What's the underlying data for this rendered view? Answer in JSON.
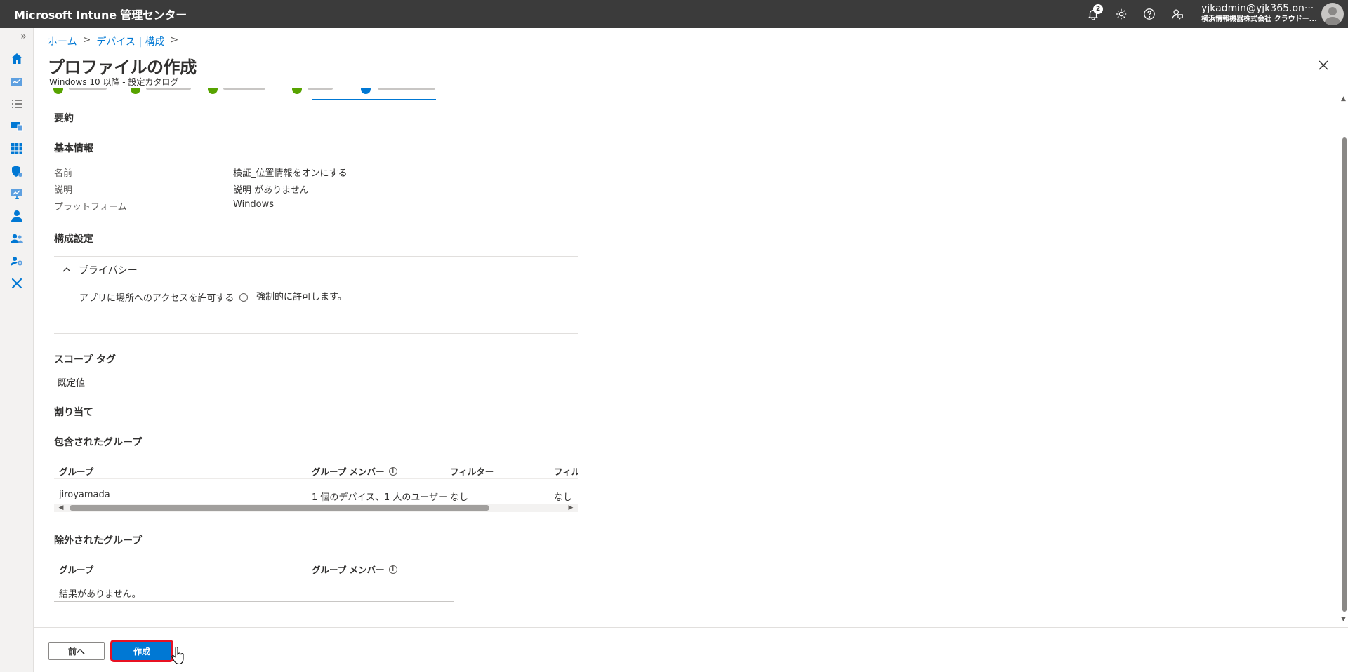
{
  "app": {
    "title": "Microsoft Intune 管理センター"
  },
  "topbar": {
    "notification_count": "2",
    "account_email": "yjkadmin@yjk365.on···",
    "account_org": "横浜情報機器株式会社  クラウドー..."
  },
  "nav": {
    "expand": "»",
    "items": [
      "home-icon",
      "dashboard-icon",
      "all-services-icon",
      "devices-icon",
      "apps-icon",
      "endpoint-security-icon",
      "reports-icon",
      "users-icon",
      "groups-icon",
      "tenant-admin-icon",
      "troubleshooting-icon"
    ]
  },
  "breadcrumb": {
    "home": "ホーム",
    "devices": "デバイス | 構成",
    "sep": ">"
  },
  "header": {
    "title": "プロファイルの作成",
    "more": "...",
    "subtitle": "Windows 10 以降 - 設定カタログ"
  },
  "summary": {
    "section_title": "要約",
    "basics_title": "基本情報",
    "basics": [
      {
        "label": "名前",
        "value": "検証_位置情報をオンにする"
      },
      {
        "label": "説明",
        "value": "説明 がありません"
      },
      {
        "label": "プラットフォーム",
        "value": "Windows"
      }
    ],
    "config_title": "構成設定",
    "category": "プライバシー",
    "setting_label": "アプリに場所へのアクセスを許可する",
    "setting_value": "強制的に許可します。",
    "scope_title": "スコープ タグ",
    "scope_value": "既定値",
    "assign_title": "割り当て",
    "included_title": "包含されたグループ",
    "included_headers": [
      "グループ",
      "グループ メンバー",
      "フィルター",
      "フィル..."
    ],
    "included_rows": [
      [
        "jiroyamada",
        "1 個のデバイス、1 人のユーザー",
        "なし",
        "なし"
      ]
    ],
    "excluded_title": "除外されたグループ",
    "excluded_headers": [
      "グループ",
      "グループ メンバー"
    ],
    "excluded_empty": "結果がありません。"
  },
  "footer": {
    "prev_label": "前へ",
    "create_label": "作成"
  },
  "colors": {
    "topbar": "#3b3b3b",
    "accent": "#0078d4",
    "highlight": "#e81123",
    "step_complete": "#57a300"
  }
}
